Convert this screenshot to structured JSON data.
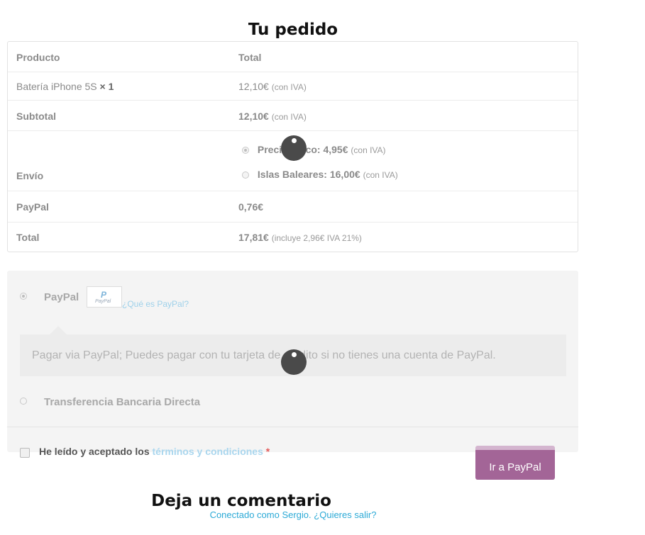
{
  "order": {
    "title": "Tu pedido",
    "header": {
      "product": "Producto",
      "total": "Total"
    },
    "item": {
      "name": "Batería iPhone 5S",
      "qty": "× 1",
      "price": "12,10€",
      "tax_note": "(con IVA)"
    },
    "subtotal": {
      "label": "Subtotal",
      "value": "12,10€",
      "tax_note": "(con IVA)"
    },
    "shipping": {
      "label": "Envío",
      "options": [
        {
          "label": "Precio único:",
          "price": "4,95€",
          "tax_note": "(con IVA)",
          "selected": true
        },
        {
          "label": "Islas Baleares:",
          "price": "16,00€",
          "tax_note": "(con IVA)",
          "selected": false
        }
      ]
    },
    "fee": {
      "label": "PayPal",
      "value": "0,76€"
    },
    "total": {
      "label": "Total",
      "value": "17,81€",
      "tax_note": "(incluye 2,96€ IVA 21%)"
    }
  },
  "payment": {
    "methods": [
      {
        "label": "PayPal",
        "selected": true,
        "link": "¿Qué es PayPal?",
        "logo_mark": "P",
        "logo_text": "PayPal"
      },
      {
        "label": "Transferencia Bancaria Directa",
        "selected": false
      }
    ],
    "description": "Pagar via PayPal; Puedes pagar con tu tarjeta de crédito si no tienes una cuenta de PayPal."
  },
  "terms": {
    "prefix": "He leído y aceptado los",
    "link": "términos y condiciones",
    "required_mark": "*"
  },
  "place_order_button": "Ir a PayPal",
  "comments": {
    "title": "Deja un comentario",
    "logged_in_as": "Conectado como Sergio",
    "logout": "¿Quieres salir?"
  },
  "colors": {
    "button": "#a36597",
    "link": "#2aa9d6"
  }
}
